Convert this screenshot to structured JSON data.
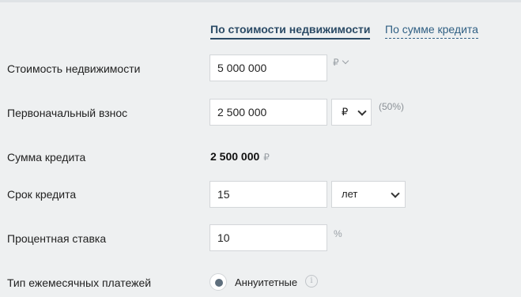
{
  "tabs": {
    "by_property_cost": "По стоимости недвижимости",
    "by_loan_amount": "По сумме кредита"
  },
  "fields": {
    "property_cost": {
      "label": "Стоимость недвижимости",
      "value": "5 000 000",
      "currency": "₽"
    },
    "down_payment": {
      "label": "Первоначальный взнос",
      "value": "2 500 000",
      "unit": "₽",
      "percent": "(50%)"
    },
    "loan_sum": {
      "label": "Сумма кредита",
      "value": "2 500 000",
      "currency": "₽"
    },
    "term": {
      "label": "Срок кредита",
      "value": "15",
      "unit": "лет"
    },
    "rate": {
      "label": "Процентная ставка",
      "value": "10",
      "unit": "%"
    },
    "payment_type": {
      "label": "Тип ежемесячных платежей",
      "option": "Аннуитетные",
      "info": "i"
    }
  }
}
